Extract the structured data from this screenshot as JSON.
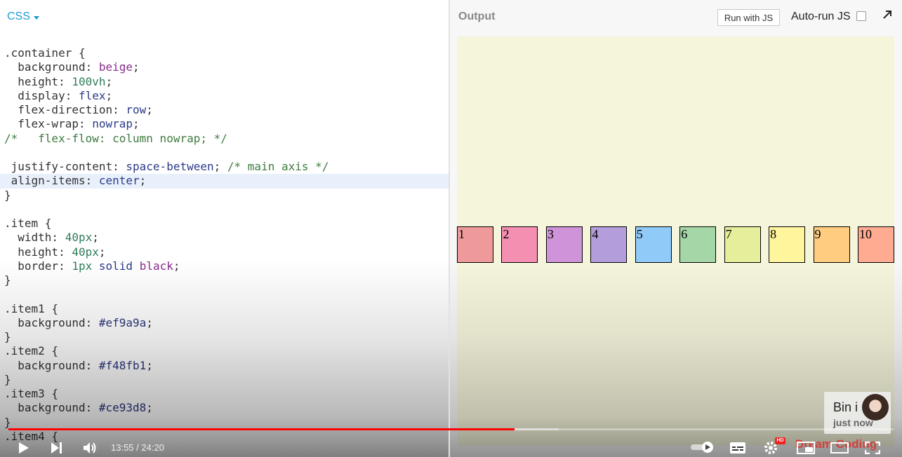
{
  "editor": {
    "language": "CSS",
    "lines": [
      [
        {
          "t": ".container {",
          "c": "tok-plain"
        }
      ],
      [
        {
          "t": "  background: ",
          "c": "tok-plain"
        },
        {
          "t": "beige",
          "c": "tok-val"
        },
        {
          "t": ";",
          "c": "tok-plain"
        }
      ],
      [
        {
          "t": "  height: ",
          "c": "tok-plain"
        },
        {
          "t": "100vh",
          "c": "tok-num"
        },
        {
          "t": ";",
          "c": "tok-plain"
        }
      ],
      [
        {
          "t": "  display: ",
          "c": "tok-plain"
        },
        {
          "t": "flex",
          "c": "tok-id"
        },
        {
          "t": ";",
          "c": "tok-plain"
        }
      ],
      [
        {
          "t": "  flex-direction: ",
          "c": "tok-plain"
        },
        {
          "t": "row",
          "c": "tok-id"
        },
        {
          "t": ";",
          "c": "tok-plain"
        }
      ],
      [
        {
          "t": "  flex-wrap: ",
          "c": "tok-plain"
        },
        {
          "t": "nowrap",
          "c": "tok-id"
        },
        {
          "t": ";",
          "c": "tok-plain"
        }
      ],
      [
        {
          "t": "/*   flex-flow: column nowrap; */",
          "c": "tok-comment"
        }
      ],
      [
        {
          "t": "",
          "c": "tok-plain"
        }
      ],
      [
        {
          "t": " justify-content: ",
          "c": "tok-plain"
        },
        {
          "t": "space-between",
          "c": "tok-id"
        },
        {
          "t": "; ",
          "c": "tok-plain"
        },
        {
          "t": "/* main axis */",
          "c": "tok-comment"
        }
      ],
      [
        {
          "t": " align-items: ",
          "c": "tok-plain"
        },
        {
          "t": "center",
          "c": "tok-id"
        },
        {
          "t": ";",
          "c": "tok-plain"
        }
      ],
      [
        {
          "t": "}",
          "c": "tok-plain"
        }
      ],
      [
        {
          "t": "",
          "c": "tok-plain"
        }
      ],
      [
        {
          "t": ".item {",
          "c": "tok-plain"
        }
      ],
      [
        {
          "t": "  width: ",
          "c": "tok-plain"
        },
        {
          "t": "40px",
          "c": "tok-num"
        },
        {
          "t": ";",
          "c": "tok-plain"
        }
      ],
      [
        {
          "t": "  height: ",
          "c": "tok-plain"
        },
        {
          "t": "40px",
          "c": "tok-num"
        },
        {
          "t": ";",
          "c": "tok-plain"
        }
      ],
      [
        {
          "t": "  border: ",
          "c": "tok-plain"
        },
        {
          "t": "1px",
          "c": "tok-num"
        },
        {
          "t": " ",
          "c": "tok-plain"
        },
        {
          "t": "solid",
          "c": "tok-id"
        },
        {
          "t": " ",
          "c": "tok-plain"
        },
        {
          "t": "black",
          "c": "tok-val"
        },
        {
          "t": ";",
          "c": "tok-plain"
        }
      ],
      [
        {
          "t": "}",
          "c": "tok-plain"
        }
      ],
      [
        {
          "t": "",
          "c": "tok-plain"
        }
      ],
      [
        {
          "t": ".item1 {",
          "c": "tok-plain"
        }
      ],
      [
        {
          "t": "  background: ",
          "c": "tok-plain"
        },
        {
          "t": "#ef9a9a",
          "c": "tok-hex"
        },
        {
          "t": ";",
          "c": "tok-plain"
        }
      ],
      [
        {
          "t": "}",
          "c": "tok-plain"
        }
      ],
      [
        {
          "t": ".item2 {",
          "c": "tok-plain"
        }
      ],
      [
        {
          "t": "  background: ",
          "c": "tok-plain"
        },
        {
          "t": "#f48fb1",
          "c": "tok-hex"
        },
        {
          "t": ";",
          "c": "tok-plain"
        }
      ],
      [
        {
          "t": "}",
          "c": "tok-plain"
        }
      ],
      [
        {
          "t": ".item3 {",
          "c": "tok-plain"
        }
      ],
      [
        {
          "t": "  background: ",
          "c": "tok-plain"
        },
        {
          "t": "#ce93d8",
          "c": "tok-hex"
        },
        {
          "t": ";",
          "c": "tok-plain"
        }
      ],
      [
        {
          "t": "}",
          "c": "tok-plain"
        }
      ],
      [
        {
          "t": ".item4 {",
          "c": "tok-plain"
        }
      ]
    ],
    "active_line": 9
  },
  "output": {
    "title": "Output",
    "run_button": "Run with JS",
    "autorun_label": "Auto-run JS",
    "autorun_checked": false,
    "container_background": "#f5f5dc",
    "items": [
      {
        "label": "1",
        "color": "#ef9a9a"
      },
      {
        "label": "2",
        "color": "#f48fb1"
      },
      {
        "label": "3",
        "color": "#ce93d8"
      },
      {
        "label": "4",
        "color": "#b39ddb"
      },
      {
        "label": "5",
        "color": "#90caf9"
      },
      {
        "label": "6",
        "color": "#a5d6a7"
      },
      {
        "label": "7",
        "color": "#e6ee9c"
      },
      {
        "label": "8",
        "color": "#fff59d"
      },
      {
        "label": "9",
        "color": "#ffcc80"
      },
      {
        "label": "10",
        "color": "#ffab91"
      }
    ]
  },
  "player": {
    "current_time": "13:55",
    "duration": "24:20",
    "time_display": "13:55 / 24:20",
    "played_fraction": 0.572,
    "buffered_fraction": 0.622,
    "hd_badge": "HD",
    "channel_watermark": "Dream Coding",
    "notification": {
      "name": "Bin i",
      "time": "just now"
    }
  },
  "colors": {
    "accent": "#1a9bd7",
    "progress": "#ff0000"
  }
}
